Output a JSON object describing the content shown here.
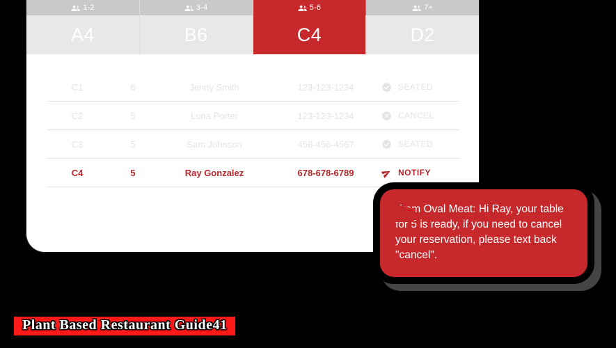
{
  "capacity_tabs": [
    {
      "label": "1-2",
      "icon": "group-icon",
      "active": false
    },
    {
      "label": "3-4",
      "icon": "group-icon",
      "active": false
    },
    {
      "label": "5-6",
      "icon": "group-icon",
      "active": true
    },
    {
      "label": "7+",
      "icon": "group-icon",
      "active": false
    }
  ],
  "table_tabs": [
    {
      "label": "A4",
      "active": false
    },
    {
      "label": "B6",
      "active": false
    },
    {
      "label": "C4",
      "active": true
    },
    {
      "label": "D2",
      "active": false
    }
  ],
  "reservations": [
    {
      "table": "C1",
      "party": "6",
      "name": "Jenny Smith",
      "phone": "123-123-1234",
      "status": "SEATED",
      "status_icon": "check-circle-icon",
      "active": false
    },
    {
      "table": "C2",
      "party": "5",
      "name": "Luna Porter",
      "phone": "123-123-1234",
      "status": "CANCEL",
      "status_icon": "x-circle-icon",
      "active": false
    },
    {
      "table": "C3",
      "party": "5",
      "name": "Sam Johnson",
      "phone": "456-456-4567",
      "status": "SEATED",
      "status_icon": "check-circle-icon",
      "active": false
    },
    {
      "table": "C4",
      "party": "5",
      "name": "Ray Gonzalez",
      "phone": "678-678-6789",
      "status": "NOTIFY",
      "status_icon": "send-icon",
      "active": true
    }
  ],
  "sms": {
    "message": "From Oval Meat: Hi Ray, your table for 5 is ready, if you need to cancel your reservation, please text back \"cancel\"."
  },
  "watermark": {
    "text": "Plant Based Restaurant Guide41"
  },
  "colors": {
    "accent_red": "#C6282B",
    "watermark_red": "#FF1A1A",
    "tab_inactive": "#E8E8E8",
    "capacity_bar": "#C9C9C9",
    "faded_text": "#E4E4E4",
    "active_row_text": "#B4282B",
    "page_background": "#000000"
  }
}
